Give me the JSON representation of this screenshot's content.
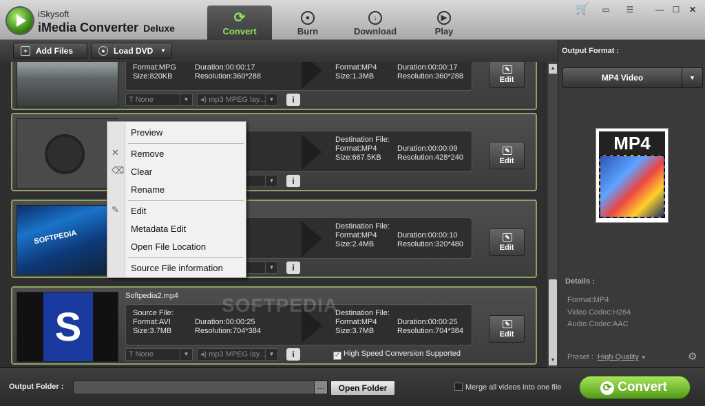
{
  "app": {
    "brand_top": "iSkysoft",
    "brand_main": "iMedia Converter",
    "brand_edition": "Deluxe"
  },
  "nav": {
    "convert": "Convert",
    "burn": "Burn",
    "download": "Download",
    "play": "Play"
  },
  "toolbar": {
    "add_files": "Add Files",
    "load_dvd": "Load DVD"
  },
  "items": [
    {
      "name": "",
      "src_label": "",
      "src_format": "Format:MPG",
      "src_duration": "Duration:00:00:17",
      "src_size": "Size:820KB",
      "src_resolution": "Resolution:360*288",
      "dst_label": "",
      "dst_format": "Format:MP4",
      "dst_duration": "Duration:00:00:17",
      "dst_size": "Size:1.3MB",
      "dst_resolution": "Resolution:360*288",
      "subtitle": "None",
      "audio": "mp3 MPEG lay..."
    },
    {
      "name": "",
      "src_format": "",
      "src_duration": "09",
      "src_size": "",
      "src_resolution": "240",
      "dst_label": "Destination File:",
      "dst_format": "Format:MP4",
      "dst_duration": "Duration:00:00:09",
      "dst_size": "Size:667.5KB",
      "dst_resolution": "Resolution:428*240"
    },
    {
      "name": "",
      "src_format": "",
      "src_duration": "10",
      "src_size": "",
      "src_resolution": "480",
      "dst_label": "Destination File:",
      "dst_format": "Format:MP4",
      "dst_duration": "Duration:00:00:10",
      "dst_size": "Size:2.4MB",
      "dst_resolution": "Resolution:320*480"
    },
    {
      "name": "Softpedia2.mp4",
      "src_label": "Source File:",
      "src_format": "Format:AVI",
      "src_duration": "Duration:00:00:25",
      "src_size": "Size:3.7MB",
      "src_resolution": "Resolution:704*384",
      "dst_label": "Destination File:",
      "dst_format": "Format:MP4",
      "dst_duration": "Duration:00:00:25",
      "dst_size": "Size:3.7MB",
      "dst_resolution": "Resolution:704*384",
      "subtitle": "None",
      "audio": "mp3 MPEG lay...",
      "high_speed": "High Speed Conversion Supported"
    }
  ],
  "edit_label": "Edit",
  "thumb_text": {
    "softpedia": "SOFTPEDIA",
    "s": "S"
  },
  "context_menu": [
    "Preview",
    "Remove",
    "Clear",
    "Rename",
    "Edit",
    "Metadata Edit",
    "Open File Location",
    "Source File information"
  ],
  "watermark": "SOFTPEDIA",
  "right": {
    "output_format_label": "Output Format :",
    "format_value": "MP4 Video",
    "format_image_text": "MP4",
    "details_label": "Details :",
    "details": [
      "Format:MP4",
      "Video Codec:H264",
      "Audio Codec:AAC"
    ],
    "preset_label": "Preset :",
    "preset_value": "High Quality"
  },
  "bottom": {
    "output_folder_label": "Output Folder :",
    "output_folder_value": "",
    "browse": "…",
    "open_folder": "Open Folder",
    "merge_label": "Merge all videos into one file",
    "convert": "Convert"
  },
  "colors": {
    "accent": "#8ee35a",
    "item_border": "#8aa564",
    "convert_green": "#5ea821"
  }
}
